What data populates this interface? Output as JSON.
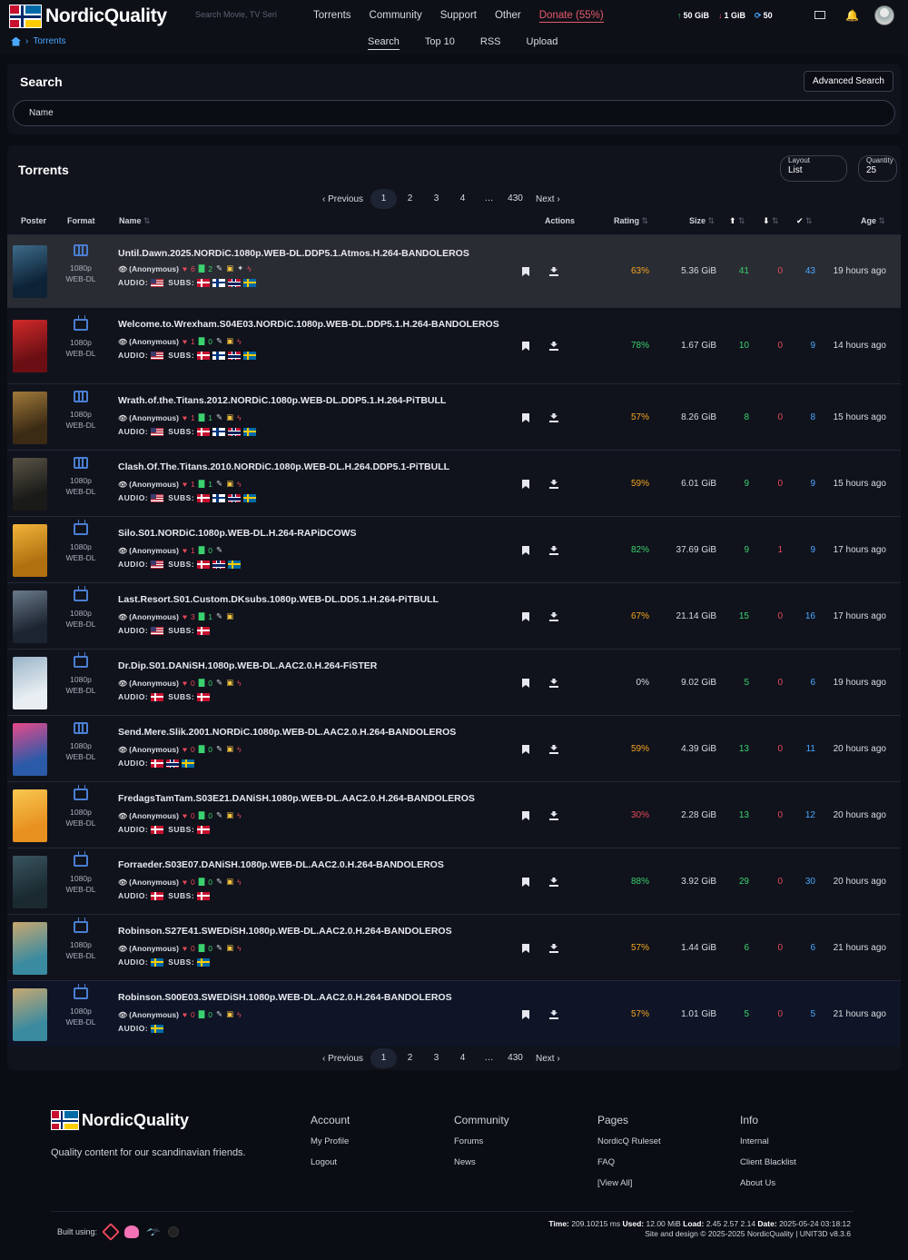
{
  "site": {
    "name": "NordicQuality"
  },
  "header": {
    "search_placeholder": "Search Movie, TV Seri",
    "nav": [
      "Torrents",
      "Community",
      "Support",
      "Other"
    ],
    "donate": "Donate (55%)",
    "upload": "50 GiB",
    "download": "1 GiB",
    "ratio": "50"
  },
  "breadcrumb": {
    "current": "Torrents"
  },
  "subnav": [
    "Search",
    "Top 10",
    "RSS",
    "Upload"
  ],
  "search": {
    "title": "Search",
    "advanced": "Advanced Search",
    "name_label": "Name"
  },
  "torrents": {
    "title": "Torrents",
    "layout_label": "Layout",
    "layout_value": "List",
    "quantity_label": "Quantity",
    "quantity_value": "25",
    "pager": {
      "prev": "‹ Previous",
      "next": "Next ›",
      "pages": [
        "1",
        "2",
        "3",
        "4",
        "…",
        "430"
      ]
    },
    "columns": {
      "poster": "Poster",
      "format": "Format",
      "name": "Name",
      "actions": "Actions",
      "rating": "Rating",
      "size": "Size",
      "age": "Age"
    },
    "audio_label": "AUDIO:",
    "subs_label": "SUBS:",
    "anon": "(Anonymous)",
    "rows": [
      {
        "name": "Until.Dawn.2025.NORDiC.1080p.WEB-DL.DDP5.1.Atmos.H.264-BANDOLEROS",
        "type": "film",
        "res": "1080p",
        "src": "WEB-DL",
        "likes": "6",
        "comments": "2",
        "audio": [
          "us"
        ],
        "subs": [
          "dk",
          "fi",
          "no",
          "se"
        ],
        "rating": "63%",
        "rating_color": "#f5a623",
        "size": "5.36 GiB",
        "seeders": "41",
        "leechers": "0",
        "completed": "43",
        "age": "19 hours ago",
        "poster": [
          "#0d2236",
          "#3d6b8a"
        ]
      },
      {
        "name": "Welcome.to.Wrexham.S04E03.NORDiC.1080p.WEB-DL.DDP5.1.H.264-BANDOLEROS",
        "type": "tv",
        "res": "1080p",
        "src": "WEB-DL",
        "likes": "1",
        "comments": "0",
        "audio": [
          "us"
        ],
        "subs": [
          "dk",
          "fi",
          "no",
          "se"
        ],
        "rating": "78%",
        "rating_color": "#3bd16f",
        "size": "1.67 GiB",
        "seeders": "10",
        "leechers": "0",
        "completed": "9",
        "age": "14 hours ago",
        "poster": [
          "#6b0f14",
          "#d12a2a"
        ]
      },
      {
        "name": "Wrath.of.the.Titans.2012.NORDiC.1080p.WEB-DL.DDP5.1.H.264-PiTBULL",
        "type": "film",
        "res": "1080p",
        "src": "WEB-DL",
        "likes": "1",
        "comments": "1",
        "audio": [
          "us"
        ],
        "subs": [
          "dk",
          "fi",
          "no",
          "se"
        ],
        "rating": "57%",
        "rating_color": "#f5a623",
        "size": "8.26 GiB",
        "seeders": "8",
        "leechers": "0",
        "completed": "8",
        "age": "15 hours ago",
        "poster": [
          "#3b2a14",
          "#a07a3a"
        ]
      },
      {
        "name": "Clash.Of.The.Titans.2010.NORDiC.1080p.WEB-DL.H.264.DDP5.1-PiTBULL",
        "type": "film",
        "res": "1080p",
        "src": "WEB-DL",
        "likes": "1",
        "comments": "1",
        "audio": [
          "us"
        ],
        "subs": [
          "dk",
          "fi",
          "no",
          "se"
        ],
        "rating": "59%",
        "rating_color": "#f5a623",
        "size": "6.01 GiB",
        "seeders": "9",
        "leechers": "0",
        "completed": "9",
        "age": "15 hours ago",
        "poster": [
          "#1a1a18",
          "#5a5446"
        ]
      },
      {
        "name": "Silo.S01.NORDiC.1080p.WEB-DL.H.264-RAPiDCOWS",
        "type": "tv",
        "res": "1080p",
        "src": "WEB-DL",
        "likes": "1",
        "comments": "0",
        "audio": [
          "us"
        ],
        "subs": [
          "dk",
          "no",
          "se"
        ],
        "rating": "82%",
        "rating_color": "#3bd16f",
        "size": "37.69 GiB",
        "seeders": "9",
        "leechers": "1",
        "completed": "9",
        "age": "17 hours ago",
        "poster": [
          "#b07010",
          "#f2b43a"
        ]
      },
      {
        "name": "Last.Resort.S01.Custom.DKsubs.1080p.WEB-DL.DD5.1.H.264-PiTBULL",
        "type": "tv",
        "res": "1080p",
        "src": "WEB-DL",
        "likes": "3",
        "comments": "1",
        "audio": [
          "us"
        ],
        "subs": [
          "dk"
        ],
        "rating": "67%",
        "rating_color": "#f5a623",
        "size": "21.14 GiB",
        "seeders": "15",
        "leechers": "0",
        "completed": "16",
        "age": "17 hours ago",
        "poster": [
          "#1c2430",
          "#6a7a8a"
        ]
      },
      {
        "name": "Dr.Dip.S01.DANiSH.1080p.WEB-DL.AAC2.0.H.264-FiSTER",
        "type": "tv",
        "res": "1080p",
        "src": "WEB-DL",
        "likes": "0",
        "comments": "0",
        "audio": [
          "dk"
        ],
        "subs": [
          "dk"
        ],
        "rating": "0%",
        "rating_color": "#d8dbe2",
        "size": "9.02 GiB",
        "seeders": "5",
        "leechers": "0",
        "completed": "6",
        "age": "19 hours ago",
        "poster": [
          "#e8eef2",
          "#9ab4c8"
        ]
      },
      {
        "name": "Send.Mere.Slik.2001.NORDiC.1080p.WEB-DL.AAC2.0.H.264-BANDOLEROS",
        "type": "film",
        "res": "1080p",
        "src": "WEB-DL",
        "likes": "0",
        "comments": "0",
        "audio": [
          "dk",
          "no",
          "se"
        ],
        "subs": [],
        "rating": "59%",
        "rating_color": "#f5a623",
        "size": "4.39 GiB",
        "seeders": "13",
        "leechers": "0",
        "completed": "11",
        "age": "20 hours ago",
        "poster": [
          "#2a5aa8",
          "#e84a8a"
        ]
      },
      {
        "name": "FredagsTamTam.S03E21.DANiSH.1080p.WEB-DL.AAC2.0.H.264-BANDOLEROS",
        "type": "tv",
        "res": "1080p",
        "src": "WEB-DL",
        "likes": "0",
        "comments": "0",
        "audio": [
          "dk"
        ],
        "subs": [
          "dk"
        ],
        "rating": "30%",
        "rating_color": "#e8485a",
        "size": "2.28 GiB",
        "seeders": "13",
        "leechers": "0",
        "completed": "12",
        "age": "20 hours ago",
        "poster": [
          "#e89020",
          "#f8c850"
        ]
      },
      {
        "name": "Forraeder.S03E07.DANiSH.1080p.WEB-DL.AAC2.0.H.264-BANDOLEROS",
        "type": "tv",
        "res": "1080p",
        "src": "WEB-DL",
        "likes": "0",
        "comments": "0",
        "audio": [
          "dk"
        ],
        "subs": [
          "dk"
        ],
        "rating": "88%",
        "rating_color": "#3bd16f",
        "size": "3.92 GiB",
        "seeders": "29",
        "leechers": "0",
        "completed": "30",
        "age": "20 hours ago",
        "poster": [
          "#1a2a30",
          "#3a5560"
        ]
      },
      {
        "name": "Robinson.S27E41.SWEDiSH.1080p.WEB-DL.AAC2.0.H.264-BANDOLEROS",
        "type": "tv",
        "res": "1080p",
        "src": "WEB-DL",
        "likes": "0",
        "comments": "0",
        "audio": [
          "se"
        ],
        "subs": [
          "se"
        ],
        "rating": "57%",
        "rating_color": "#f5a623",
        "size": "1.44 GiB",
        "seeders": "6",
        "leechers": "0",
        "completed": "6",
        "age": "21 hours ago",
        "poster": [
          "#3a8aa0",
          "#c8a870"
        ]
      },
      {
        "name": "Robinson.S00E03.SWEDiSH.1080p.WEB-DL.AAC2.0.H.264-BANDOLEROS",
        "type": "tv",
        "res": "1080p",
        "src": "WEB-DL",
        "likes": "0",
        "comments": "0",
        "audio": [
          "se"
        ],
        "subs": [],
        "rating": "57%",
        "rating_color": "#f5a623",
        "size": "1.01 GiB",
        "seeders": "5",
        "leechers": "0",
        "completed": "5",
        "age": "21 hours ago",
        "poster": [
          "#3a8aa0",
          "#c8a870"
        ]
      }
    ]
  },
  "footer": {
    "tagline": "Quality content for our scandinavian friends.",
    "columns": [
      {
        "title": "Account",
        "links": [
          "My Profile",
          "Logout"
        ]
      },
      {
        "title": "Community",
        "links": [
          "Forums",
          "News"
        ]
      },
      {
        "title": "Pages",
        "links": [
          "NordicQ Ruleset",
          "FAQ",
          "[View All]"
        ]
      },
      {
        "title": "Info",
        "links": [
          "Internal",
          "Client Blacklist",
          "About Us"
        ]
      }
    ],
    "built_using": "Built using:",
    "timing_time_label": "Time:",
    "timing_time": "209.10215 ms",
    "timing_used_label": "Used:",
    "timing_used": "12.00 MiB",
    "timing_load_label": "Load:",
    "timing_load": "2.45 2.57 2.14",
    "timing_date_label": "Date:",
    "timing_date": "2025-05-24 03:18:12",
    "credits": "Site and design © 2025-2025 NordicQuality | UNIT3D v8.3.6"
  }
}
